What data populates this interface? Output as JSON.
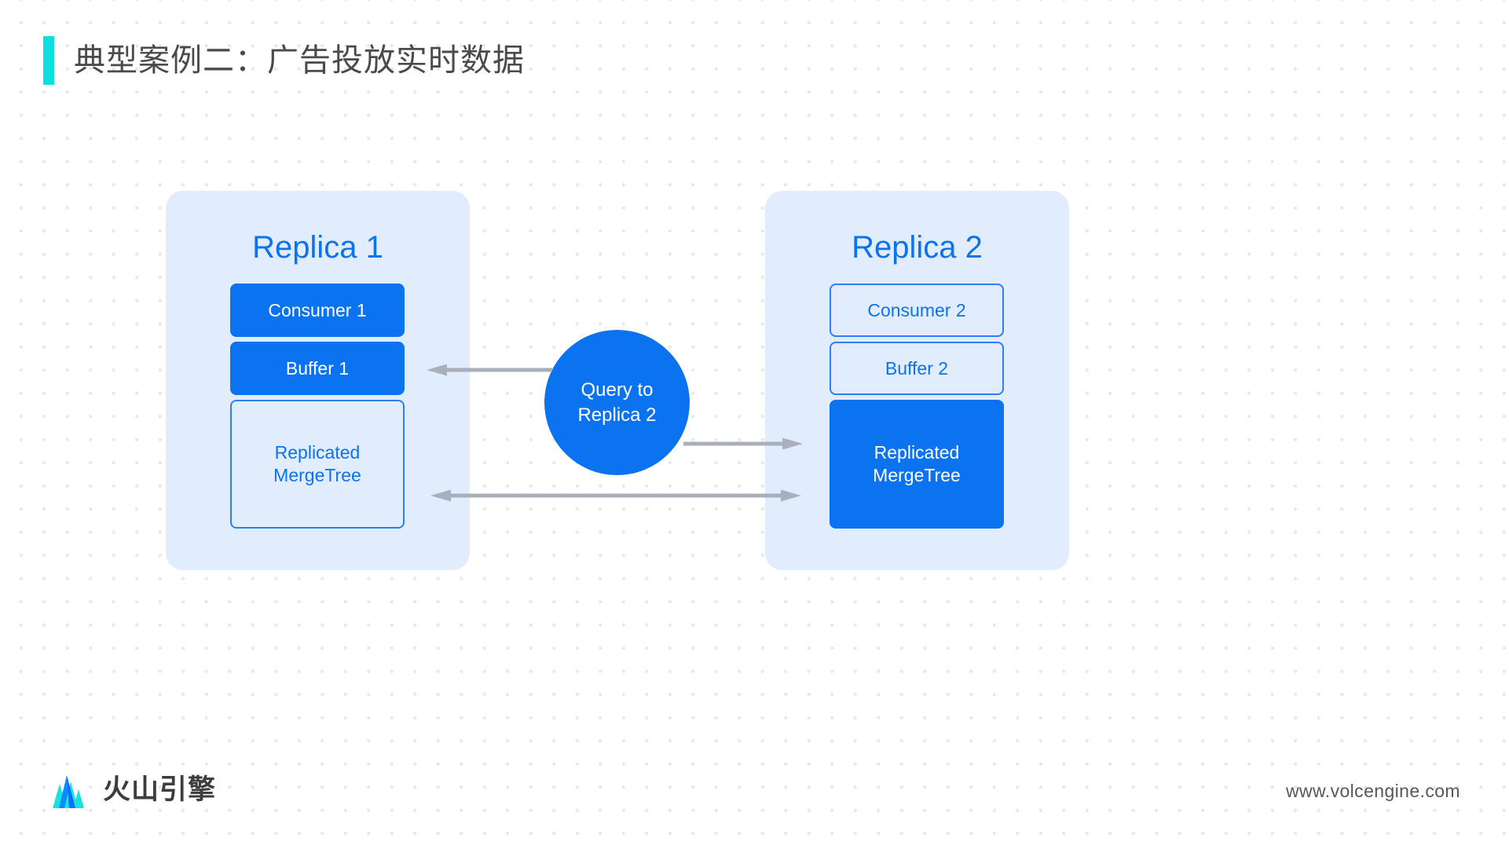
{
  "slide": {
    "title": "典型案例二：广告投放实时数据",
    "accent_color": "#0ddfe1",
    "brand_blue": "#0b72f0",
    "panel_blue": "#e1edfc",
    "arrow_gray": "#a9b0bb"
  },
  "replica_1": {
    "title": "Replica 1",
    "nodes": [
      {
        "label": "Consumer  1",
        "style": "filled"
      },
      {
        "label": "Buffer  1",
        "style": "filled"
      },
      {
        "label": "Replicated\nMergeTree",
        "line1": "Replicated",
        "line2": "MergeTree",
        "style": "outlined"
      }
    ]
  },
  "replica_2": {
    "title": "Replica 2",
    "nodes": [
      {
        "label": "Consumer  2",
        "style": "outlined"
      },
      {
        "label": "Buffer  2",
        "style": "outlined"
      },
      {
        "label": "Replicated\nMergeTree",
        "line1": "Replicated",
        "line2": "MergeTree",
        "style": "filled"
      }
    ]
  },
  "query": {
    "line1": "Query to",
    "line2": "Replica 2"
  },
  "arrows": [
    {
      "name": "arrow-to-replica-1",
      "direction": "left",
      "from": "query-circle",
      "to": "buffer-1-box"
    },
    {
      "name": "arrow-to-replica-2",
      "direction": "right",
      "from": "query-circle",
      "to": "replicated-mt-2-box"
    },
    {
      "name": "arrow-replication",
      "direction": "both",
      "from": "replicated-mt-1-box",
      "to": "replicated-mt-2-box"
    }
  ],
  "footer": {
    "logo_text": "火山引擎",
    "url": "www.volcengine.com"
  }
}
